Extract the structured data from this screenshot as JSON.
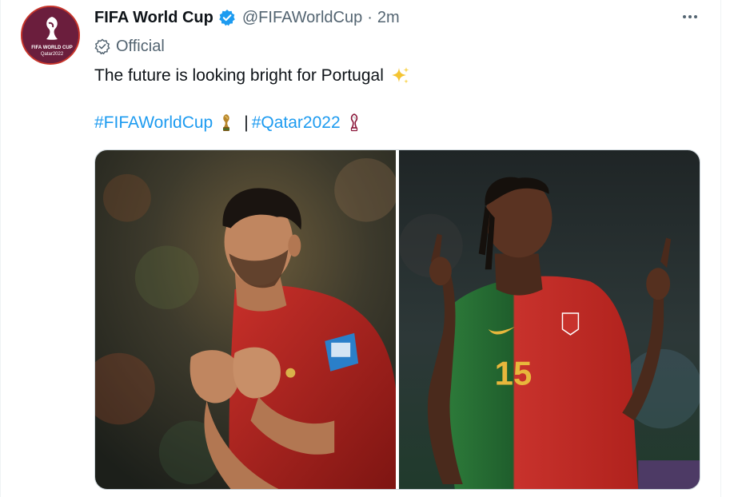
{
  "account": {
    "display_name": "FIFA World Cup",
    "handle": "@FIFAWorldCup",
    "separator": "·",
    "time": "2m",
    "label": "Official",
    "avatar_text_1": "FIFA WORLD CUP",
    "avatar_text_2": "Qatar2022"
  },
  "tweet": {
    "text": "The future is looking bright for Portugal",
    "hashtag_1": "#FIFAWorldCup",
    "divider": "|",
    "hashtag_2": "#Qatar2022"
  },
  "media": {
    "photo_2_number": "15"
  },
  "icons": [
    "verified-icon",
    "more-icon",
    "official-icon",
    "sparkle-icon",
    "trophy-icon",
    "trophy-outline-icon"
  ],
  "colors": {
    "link": "#1d9bf0",
    "verified": "#1d9bf0",
    "secondary_text": "#536471",
    "avatar_bg": "#6b1e3d"
  }
}
